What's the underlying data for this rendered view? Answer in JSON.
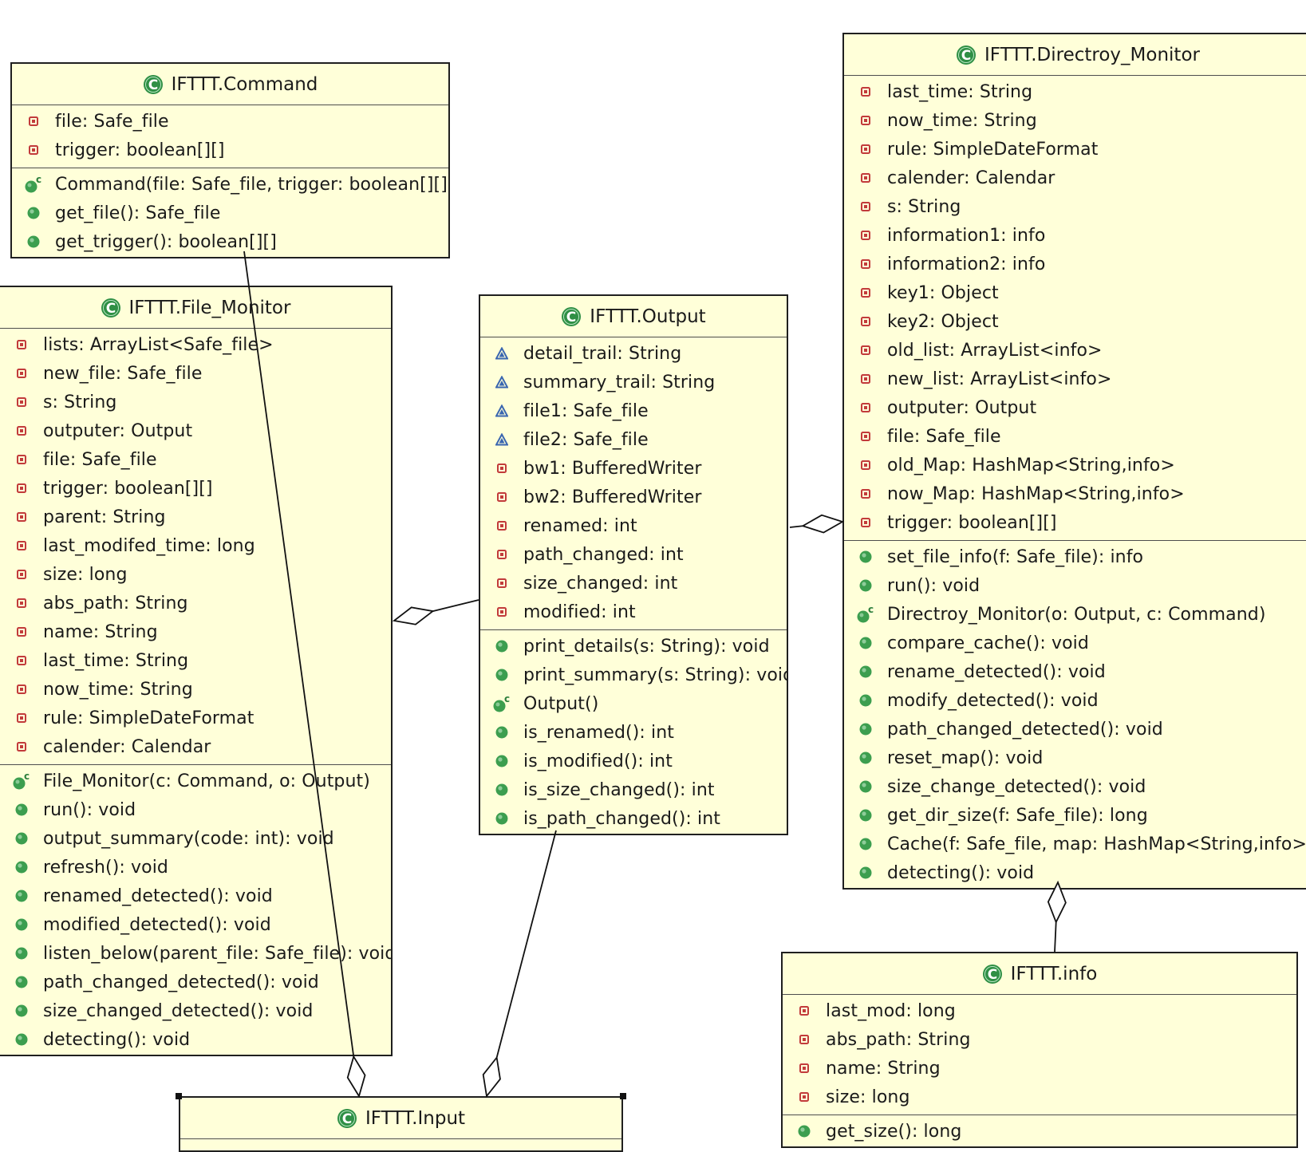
{
  "classes": [
    {
      "id": "command",
      "name": "IFTTT.Command",
      "fields": [
        {
          "text": "file: Safe_file",
          "vis": "private"
        },
        {
          "text": "trigger: boolean[][]",
          "vis": "private"
        }
      ],
      "methods": [
        {
          "text": "Command(file: Safe_file, trigger: boolean[][])",
          "kind": "constructor"
        },
        {
          "text": "get_file(): Safe_file",
          "kind": "public"
        },
        {
          "text": "get_trigger(): boolean[][]",
          "kind": "public"
        }
      ]
    },
    {
      "id": "file-monitor",
      "name": "IFTTT.File_Monitor",
      "fields": [
        {
          "text": "lists: ArrayList<Safe_file>",
          "vis": "private"
        },
        {
          "text": "new_file: Safe_file",
          "vis": "private"
        },
        {
          "text": "s: String",
          "vis": "private"
        },
        {
          "text": "outputer: Output",
          "vis": "private"
        },
        {
          "text": "file: Safe_file",
          "vis": "private"
        },
        {
          "text": "trigger: boolean[][]",
          "vis": "private"
        },
        {
          "text": "parent: String",
          "vis": "private"
        },
        {
          "text": "last_modifed_time: long",
          "vis": "private"
        },
        {
          "text": "size: long",
          "vis": "private"
        },
        {
          "text": "abs_path: String",
          "vis": "private"
        },
        {
          "text": "name: String",
          "vis": "private"
        },
        {
          "text": "last_time: String",
          "vis": "private"
        },
        {
          "text": "now_time: String",
          "vis": "private"
        },
        {
          "text": "rule: SimpleDateFormat",
          "vis": "private"
        },
        {
          "text": "calender: Calendar",
          "vis": "private"
        }
      ],
      "methods": [
        {
          "text": "File_Monitor(c: Command, o: Output)",
          "kind": "constructor"
        },
        {
          "text": "run(): void",
          "kind": "public"
        },
        {
          "text": "output_summary(code: int): void",
          "kind": "public"
        },
        {
          "text": "refresh(): void",
          "kind": "public"
        },
        {
          "text": "renamed_detected(): void",
          "kind": "public"
        },
        {
          "text": "modified_detected(): void",
          "kind": "public"
        },
        {
          "text": "listen_below(parent_file: Safe_file): void",
          "kind": "public"
        },
        {
          "text": "path_changed_detected(): void",
          "kind": "public"
        },
        {
          "text": "size_changed_detected(): void",
          "kind": "public"
        },
        {
          "text": "detecting(): void",
          "kind": "public"
        }
      ]
    },
    {
      "id": "output",
      "name": "IFTTT.Output",
      "fields": [
        {
          "text": "detail_trail: String",
          "vis": "package"
        },
        {
          "text": "summary_trail: String",
          "vis": "package"
        },
        {
          "text": "file1: Safe_file",
          "vis": "package"
        },
        {
          "text": "file2: Safe_file",
          "vis": "package"
        },
        {
          "text": "bw1: BufferedWriter",
          "vis": "private"
        },
        {
          "text": "bw2: BufferedWriter",
          "vis": "private"
        },
        {
          "text": "renamed: int",
          "vis": "private"
        },
        {
          "text": "path_changed: int",
          "vis": "private"
        },
        {
          "text": "size_changed: int",
          "vis": "private"
        },
        {
          "text": "modified: int",
          "vis": "private"
        }
      ],
      "methods": [
        {
          "text": "print_details(s: String): void",
          "kind": "public"
        },
        {
          "text": "print_summary(s: String): void",
          "kind": "public"
        },
        {
          "text": "Output()",
          "kind": "constructor"
        },
        {
          "text": "is_renamed(): int",
          "kind": "public"
        },
        {
          "text": "is_modified(): int",
          "kind": "public"
        },
        {
          "text": "is_size_changed(): int",
          "kind": "public"
        },
        {
          "text": "is_path_changed(): int",
          "kind": "public"
        }
      ]
    },
    {
      "id": "directroy-monitor",
      "name": "IFTTT.Directroy_Monitor",
      "fields": [
        {
          "text": "last_time: String",
          "vis": "private"
        },
        {
          "text": "now_time: String",
          "vis": "private"
        },
        {
          "text": "rule: SimpleDateFormat",
          "vis": "private"
        },
        {
          "text": "calender: Calendar",
          "vis": "private"
        },
        {
          "text": "s: String",
          "vis": "private"
        },
        {
          "text": "information1: info",
          "vis": "private"
        },
        {
          "text": "information2: info",
          "vis": "private"
        },
        {
          "text": "key1: Object",
          "vis": "private"
        },
        {
          "text": "key2: Object",
          "vis": "private"
        },
        {
          "text": "old_list: ArrayList<info>",
          "vis": "private"
        },
        {
          "text": "new_list: ArrayList<info>",
          "vis": "private"
        },
        {
          "text": "outputer: Output",
          "vis": "private"
        },
        {
          "text": "file: Safe_file",
          "vis": "private"
        },
        {
          "text": "old_Map: HashMap<String,info>",
          "vis": "private"
        },
        {
          "text": "now_Map: HashMap<String,info>",
          "vis": "private"
        },
        {
          "text": "trigger: boolean[][]",
          "vis": "private"
        }
      ],
      "methods": [
        {
          "text": "set_file_info(f: Safe_file): info",
          "kind": "public"
        },
        {
          "text": "run(): void",
          "kind": "public"
        },
        {
          "text": "Directroy_Monitor(o: Output, c: Command)",
          "kind": "constructor"
        },
        {
          "text": "compare_cache(): void",
          "kind": "public"
        },
        {
          "text": "rename_detected(): void",
          "kind": "public"
        },
        {
          "text": "modify_detected(): void",
          "kind": "public"
        },
        {
          "text": "path_changed_detected(): void",
          "kind": "public"
        },
        {
          "text": "reset_map(): void",
          "kind": "public"
        },
        {
          "text": "size_change_detected(): void",
          "kind": "public"
        },
        {
          "text": "get_dir_size(f: Safe_file): long",
          "kind": "public"
        },
        {
          "text": "Cache(f: Safe_file, map: HashMap<String,info>)",
          "kind": "public"
        },
        {
          "text": "detecting(): void",
          "kind": "public"
        }
      ]
    },
    {
      "id": "info",
      "name": "IFTTT.info",
      "fields": [
        {
          "text": "last_mod: long",
          "vis": "private"
        },
        {
          "text": "abs_path: String",
          "vis": "private"
        },
        {
          "text": "name: String",
          "vis": "private"
        },
        {
          "text": "size: long",
          "vis": "private"
        }
      ],
      "methods": [
        {
          "text": "get_size(): long",
          "kind": "public"
        }
      ]
    },
    {
      "id": "input",
      "name": "IFTTT.Input",
      "fields": [],
      "methods": []
    }
  ],
  "relations": [
    {
      "type": "aggregation",
      "whole": "input",
      "part": "command"
    },
    {
      "type": "aggregation",
      "whole": "input",
      "part": "output"
    },
    {
      "type": "aggregation",
      "whole": "file-monitor",
      "part": "output"
    },
    {
      "type": "aggregation",
      "whole": "directroy-monitor",
      "part": "output"
    },
    {
      "type": "aggregation",
      "whole": "directroy-monitor",
      "part": "info"
    }
  ],
  "colors": {
    "class_fill": "#ffffd9",
    "border": "#1f1f1f",
    "private_icon": "#c23b3b",
    "package_icon": "#3a66b0",
    "public_icon": "#3c9e4f",
    "class_icon": "#2f8f45"
  },
  "icons": {
    "class": "class-c-icon",
    "private": "private-field-icon",
    "package": "package-field-icon",
    "public": "public-method-icon",
    "constructor": "constructor-icon"
  }
}
